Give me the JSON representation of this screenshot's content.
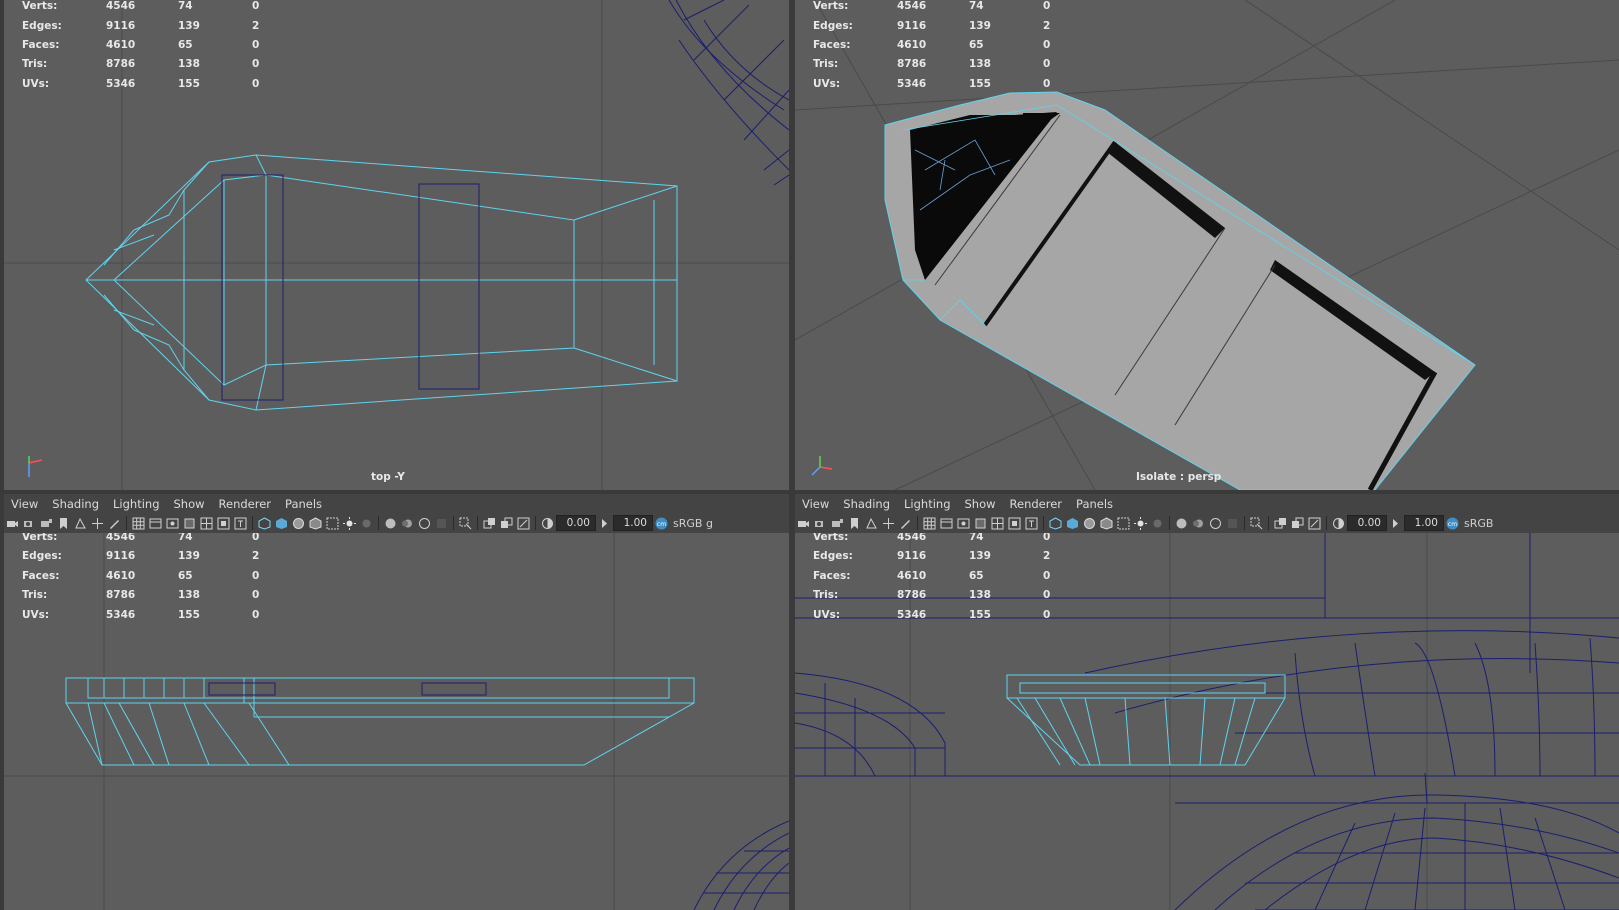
{
  "hud_stats": {
    "rows": [
      {
        "label": "Verts:",
        "total": "4546",
        "selected": "74",
        "extra": "0"
      },
      {
        "label": "Edges:",
        "total": "9116",
        "selected": "139",
        "extra": "2"
      },
      {
        "label": "Faces:",
        "total": "4610",
        "selected": "65",
        "extra": "0"
      },
      {
        "label": "Tris:",
        "total": "8786",
        "selected": "138",
        "extra": "0"
      },
      {
        "label": "UVs:",
        "total": "5346",
        "selected": "155",
        "extra": "0"
      }
    ]
  },
  "viewports": {
    "top_left": {
      "camera_label": "top -Y"
    },
    "top_right": {
      "camera_label": "Isolate : persp"
    }
  },
  "panel_menu": {
    "items": [
      "View",
      "Shading",
      "Lighting",
      "Show",
      "Renderer",
      "Panels"
    ]
  },
  "panel_toolbar": {
    "exposure_value": "0.00",
    "gamma_value": "1.00",
    "colorspace_left": "sRGB g",
    "colorspace_right": "sRGB"
  },
  "colors": {
    "viewport_bg": "#5d5d5d",
    "wire_selected": "#5fd4ee",
    "wire_dark": "#1a1f6e",
    "grid": "#4a4a4a",
    "mesh_face": "#a6a6a6"
  },
  "icons": [
    "camera-icon",
    "grid-icon",
    "wireframe-icon",
    "smooth-shade-icon",
    "xray-icon",
    "light-icon",
    "isolate-icon",
    "exposure-icon",
    "gamma-icon",
    "colorspace-icon"
  ]
}
